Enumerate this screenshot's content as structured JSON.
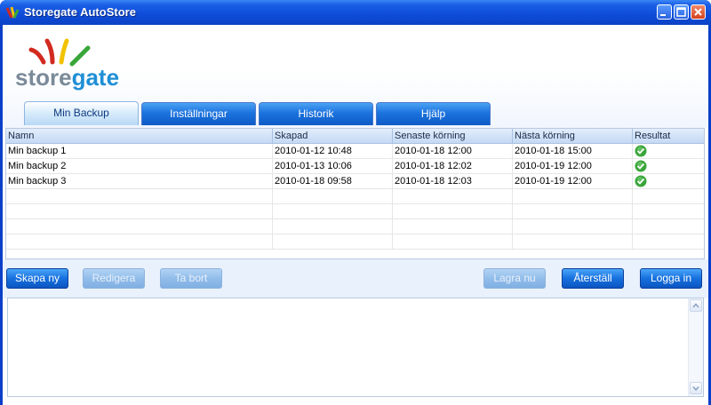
{
  "window": {
    "title": "Storegate AutoStore"
  },
  "logo": {
    "text_store": "store",
    "text_gate": "gate",
    "colors": {
      "store": "#7a8a99",
      "gate": "#1f8fd6",
      "stripes": [
        "#d22a1f",
        "#f2c200",
        "#3aa63a"
      ]
    }
  },
  "tabs": [
    {
      "label": "Min Backup",
      "active": true
    },
    {
      "label": "Inställningar",
      "active": false
    },
    {
      "label": "Historik",
      "active": false
    },
    {
      "label": "Hjälp",
      "active": false
    }
  ],
  "table": {
    "columns": [
      "Namn",
      "Skapad",
      "Senaste körning",
      "Nästa körning",
      "Resultat"
    ],
    "rows": [
      {
        "name": "Min backup 1",
        "created": "2010-01-12 10:48",
        "last_run": "2010-01-18 12:00",
        "next_run": "2010-01-18 15:00",
        "result": "ok-icon"
      },
      {
        "name": "Min backup 2",
        "created": "2010-01-13 10:06",
        "last_run": "2010-01-18 12:02",
        "next_run": "2010-01-19 12:00",
        "result": "ok-icon"
      },
      {
        "name": "Min backup 3",
        "created": "2010-01-18 09:58",
        "last_run": "2010-01-18 12:03",
        "next_run": "2010-01-19 12:00",
        "result": "ok-icon"
      }
    ]
  },
  "buttons": {
    "create": "Skapa ny",
    "edit": "Redigera",
    "delete": "Ta bort",
    "save_now": "Lagra nu",
    "restore": "Återställ",
    "login": "Logga in"
  },
  "colors": {
    "accent": "#1670de",
    "titlebar": "#0e4cd8",
    "ok": "#3aa63a"
  }
}
